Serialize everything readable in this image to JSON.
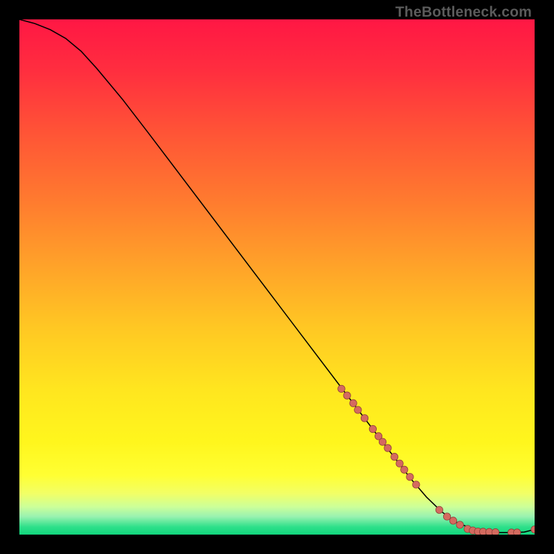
{
  "watermark": "TheBottleneck.com",
  "colors": {
    "curve": "#000000",
    "marker_fill": "#d46a5f",
    "marker_stroke": "#8f3f38",
    "bg_black": "#000000"
  },
  "gradient_stops": [
    {
      "offset": 0.0,
      "color": "#ff1744"
    },
    {
      "offset": 0.1,
      "color": "#ff2e3f"
    },
    {
      "offset": 0.22,
      "color": "#ff5436"
    },
    {
      "offset": 0.35,
      "color": "#ff7a2f"
    },
    {
      "offset": 0.48,
      "color": "#ffa329"
    },
    {
      "offset": 0.6,
      "color": "#ffc823"
    },
    {
      "offset": 0.72,
      "color": "#ffe61f"
    },
    {
      "offset": 0.82,
      "color": "#fff61d"
    },
    {
      "offset": 0.885,
      "color": "#ffff33"
    },
    {
      "offset": 0.92,
      "color": "#f2ff66"
    },
    {
      "offset": 0.946,
      "color": "#ccff99"
    },
    {
      "offset": 0.965,
      "color": "#99f2b0"
    },
    {
      "offset": 0.985,
      "color": "#2ee08a"
    },
    {
      "offset": 1.0,
      "color": "#11d67d"
    }
  ],
  "chart_data": {
    "type": "line",
    "title": "",
    "xlabel": "",
    "ylabel": "",
    "xlim": [
      0,
      100
    ],
    "ylim": [
      0,
      100
    ],
    "grid": false,
    "legend": false,
    "series": [
      {
        "name": "curve",
        "style": "line",
        "x": [
          0,
          3,
          6,
          9,
          12,
          15,
          20,
          25,
          30,
          35,
          40,
          45,
          50,
          55,
          60,
          65,
          70,
          73,
          76,
          79,
          82,
          85,
          88,
          90,
          92,
          94,
          96,
          98,
          100
        ],
        "y": [
          100,
          99.2,
          98.0,
          96.3,
          93.8,
          90.5,
          84.5,
          78.0,
          71.4,
          64.8,
          58.2,
          51.6,
          45.0,
          38.4,
          31.8,
          25.2,
          18.6,
          14.7,
          10.8,
          7.3,
          4.4,
          2.3,
          1.1,
          0.55,
          0.4,
          0.4,
          0.4,
          0.5,
          1.0
        ]
      },
      {
        "name": "markers",
        "style": "scatter",
        "x": [
          62.5,
          63.6,
          64.8,
          65.7,
          67.0,
          68.6,
          69.7,
          70.5,
          71.5,
          72.8,
          73.8,
          74.7,
          75.8,
          77.0,
          81.5,
          83.0,
          84.2,
          85.5,
          87.0,
          88.0,
          89.0,
          90.0,
          91.2,
          92.4,
          95.5,
          96.6,
          100.0
        ],
        "y": [
          28.3,
          27.0,
          25.5,
          24.2,
          22.6,
          20.5,
          19.1,
          18.0,
          16.8,
          15.1,
          13.8,
          12.6,
          11.2,
          9.7,
          4.8,
          3.5,
          2.7,
          1.9,
          1.1,
          0.8,
          0.6,
          0.55,
          0.5,
          0.45,
          0.4,
          0.4,
          1.0
        ]
      }
    ]
  }
}
